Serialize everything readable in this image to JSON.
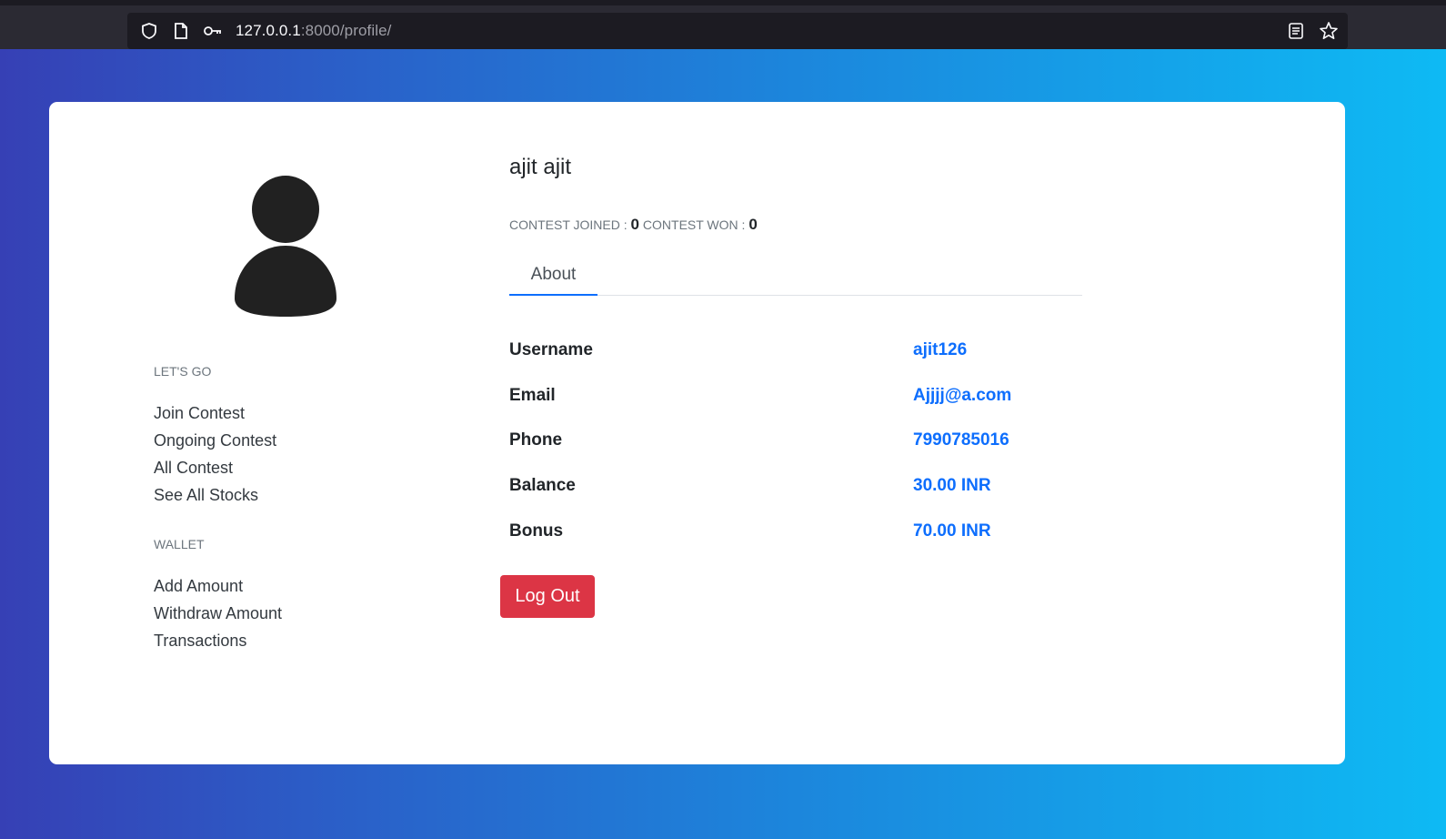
{
  "browser": {
    "url_host": "127.0.0.1",
    "url_path": ":8000/profile/"
  },
  "profile": {
    "name": "ajit ajit",
    "contest_joined_label": "CONTEST JOINED :",
    "contest_joined_value": "0",
    "contest_won_label": "CONTEST WON :",
    "contest_won_value": "0"
  },
  "sidebar": {
    "lets_go_title": "LET'S GO",
    "lets_go_items": [
      "Join Contest",
      "Ongoing Contest",
      "All Contest",
      "See All Stocks"
    ],
    "wallet_title": "WALLET",
    "wallet_items": [
      "Add Amount",
      "Withdraw Amount",
      "Transactions"
    ]
  },
  "tabs": {
    "about": "About"
  },
  "info": [
    {
      "label": "Username",
      "value": "ajit126"
    },
    {
      "label": "Email",
      "value": "Ajjjj@a.com"
    },
    {
      "label": "Phone",
      "value": "7990785016"
    },
    {
      "label": "Balance",
      "value": "30.00 INR"
    },
    {
      "label": "Bonus",
      "value": "70.00 INR"
    }
  ],
  "actions": {
    "logout": "Log Out"
  },
  "colors": {
    "primary": "#0d6efd",
    "danger": "#dc3545",
    "gradient_start": "#3640b5",
    "gradient_end": "#0ebaf4"
  }
}
